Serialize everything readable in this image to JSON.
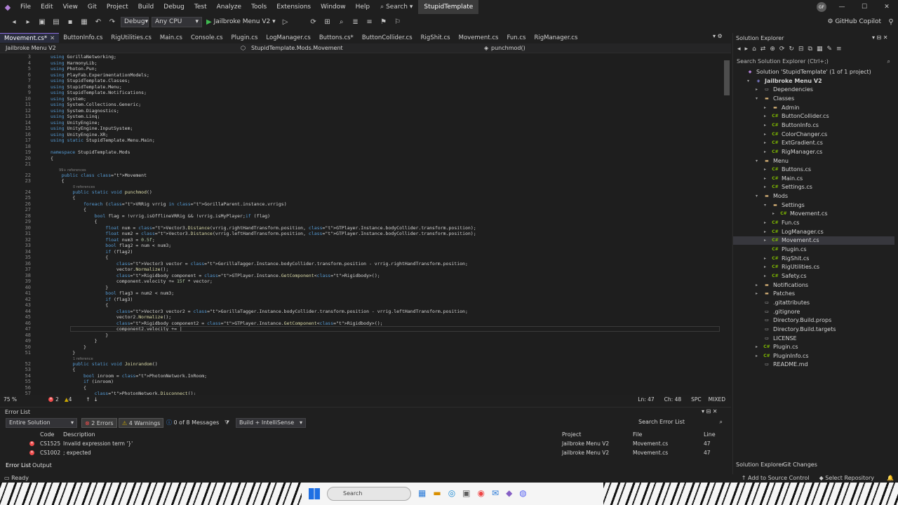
{
  "menubar": {
    "items": [
      "File",
      "Edit",
      "View",
      "Git",
      "Project",
      "Build",
      "Debug",
      "Test",
      "Analyze",
      "Tools",
      "Extensions",
      "Window",
      "Help"
    ],
    "search": "Search",
    "solution_name": "StupidTemplate",
    "avatar_initials": "GF"
  },
  "toolbar": {
    "config": "Debug",
    "platform": "Any CPU",
    "startup": "Jailbroke Menu V2",
    "copilot": "GitHub Copilot"
  },
  "tabs": [
    {
      "label": "Movement.cs*",
      "active": true
    },
    {
      "label": "ButtonInfo.cs"
    },
    {
      "label": "RigUtilities.cs"
    },
    {
      "label": "Main.cs"
    },
    {
      "label": "Console.cs"
    },
    {
      "label": "Plugin.cs"
    },
    {
      "label": "LogManager.cs"
    },
    {
      "label": "Buttons.cs*"
    },
    {
      "label": "ButtonCollider.cs"
    },
    {
      "label": "RigShit.cs"
    },
    {
      "label": "Movement.cs"
    },
    {
      "label": "Fun.cs"
    },
    {
      "label": "RigManager.cs"
    }
  ],
  "navbar": {
    "project": "Jailbroke Menu V2",
    "class": "StupidTemplate.Mods.Movement",
    "member": "punchmod()"
  },
  "editor": {
    "lines": [
      {
        "n": "3",
        "code": "using GorillaNetworking;"
      },
      {
        "n": "4",
        "code": "using HarmonyLib;"
      },
      {
        "n": "5",
        "code": "using Photon.Pun;"
      },
      {
        "n": "6",
        "code": "using PlayFab.ExperimentationModels;"
      },
      {
        "n": "7",
        "code": "using StupidTemplate.Classes;"
      },
      {
        "n": "8",
        "code": "using StupidTemplate.Menu;"
      },
      {
        "n": "9",
        "code": "using StupidTemplate.Notifications;"
      },
      {
        "n": "10",
        "code": "using System;"
      },
      {
        "n": "11",
        "code": "using System.Collections.Generic;"
      },
      {
        "n": "12",
        "code": "using System.Diagnostics;"
      },
      {
        "n": "13",
        "code": "using System.Linq;"
      },
      {
        "n": "14",
        "code": "using UnityEngine;"
      },
      {
        "n": "15",
        "code": "using UnityEngine.InputSystem;"
      },
      {
        "n": "16",
        "code": "using UnityEngine.XR;"
      },
      {
        "n": "17",
        "code": "using static StupidTemplate.Menu.Main;"
      },
      {
        "n": "18",
        "code": ""
      },
      {
        "n": "19",
        "code": "namespace StupidTemplate.Mods"
      },
      {
        "n": "20",
        "code": "{"
      },
      {
        "n": "21",
        "code": ""
      },
      {
        "n": "",
        "lens": "99+ references"
      },
      {
        "n": "22",
        "code": "    public class Movement"
      },
      {
        "n": "23",
        "code": "    {"
      },
      {
        "n": "",
        "lens": "0 references"
      },
      {
        "n": "24",
        "code": "        public static void punchmod()"
      },
      {
        "n": "25",
        "code": "        {"
      },
      {
        "n": "26",
        "code": "            foreach (VRRig vrrig in GorillaParent.instance.vrrigs)"
      },
      {
        "n": "27",
        "code": "            {"
      },
      {
        "n": "28",
        "code": "                bool flag = !vrrig.isOfflineVRRig && !vrrig.isMyPlayer;if (flag)"
      },
      {
        "n": "29",
        "code": "                {"
      },
      {
        "n": "30",
        "code": "                    float num = Vector3.Distance(vrrig.rightHandTransform.position, GTPlayer.Instance.bodyCollider.transform.position);"
      },
      {
        "n": "31",
        "code": "                    float num2 = Vector3.Distance(vrrig.leftHandTransform.position, GTPlayer.Instance.bodyCollider.transform.position);"
      },
      {
        "n": "32",
        "code": "                    float num3 = 0.5f;"
      },
      {
        "n": "33",
        "code": "                    bool flag2 = num < num3;"
      },
      {
        "n": "34",
        "code": "                    if (flag2)"
      },
      {
        "n": "35",
        "code": "                    {"
      },
      {
        "n": "36",
        "code": "                        Vector3 vector = GorillaTagger.Instance.bodyCollider.transform.position - vrrig.rightHandTransform.position;"
      },
      {
        "n": "37",
        "code": "                        vector.Normalize();"
      },
      {
        "n": "38",
        "code": "                        Rigidbody component = GTPlayer.Instance.GetComponent<Rigidbody>();"
      },
      {
        "n": "39",
        "code": "                        component.velocity += 15f * vector;"
      },
      {
        "n": "40",
        "code": "                    }"
      },
      {
        "n": "41",
        "code": "                    bool flag3 = num2 < num3;"
      },
      {
        "n": "42",
        "code": "                    if (flag3)"
      },
      {
        "n": "43",
        "code": "                    {"
      },
      {
        "n": "44",
        "code": "                        Vector3 vector2 = GorillaTagger.Instance.bodyCollider.transform.position - vrrig.leftHandTransform.position;"
      },
      {
        "n": "45",
        "code": "                        vector2.Normalize();"
      },
      {
        "n": "46",
        "code": "                        Rigidbody component2 = GTPlayer.Instance.GetComponent<Rigidbody>();"
      },
      {
        "n": "47",
        "code": "                        component2.velocity += |"
      },
      {
        "n": "48",
        "code": "                    }"
      },
      {
        "n": "49",
        "code": "                }"
      },
      {
        "n": "50",
        "code": "            }"
      },
      {
        "n": "51",
        "code": "        }"
      },
      {
        "n": "",
        "lens": "1 reference"
      },
      {
        "n": "52",
        "code": "        public static void Joinrandom()"
      },
      {
        "n": "53",
        "code": "        {"
      },
      {
        "n": "54",
        "code": "            bool inroom = PhotonNetwork.InRoom;"
      },
      {
        "n": "55",
        "code": "            if (inroom)"
      },
      {
        "n": "56",
        "code": "            {"
      },
      {
        "n": "57",
        "code": "                PhotonNetwork.Disconnect();"
      }
    ]
  },
  "editor_status": {
    "zoom": "75 %",
    "errors": "2",
    "warnings": "4",
    "position": "Ln: 47",
    "column": "Ch: 48",
    "spaces": "SPC",
    "eol": "MIXED"
  },
  "error_list": {
    "title": "Error List",
    "scope": "Entire Solution",
    "errors_btn": "2 Errors",
    "warnings_btn": "4 Warnings",
    "messages_btn": "0 of 8 Messages",
    "build_filter": "Build + IntelliSense",
    "search_placeholder": "Search Error List",
    "headers": {
      "code": "Code",
      "description": "Description",
      "project": "Project",
      "file": "File",
      "line": "Line"
    },
    "rows": [
      {
        "code": "CS1525",
        "description": "Invalid expression term '}'",
        "project": "Jailbroke Menu V2",
        "file": "Movement.cs",
        "line": "47"
      },
      {
        "code": "CS1002",
        "description": "; expected",
        "project": "Jailbroke Menu V2",
        "file": "Movement.cs",
        "line": "47"
      }
    ],
    "bottom_tabs": [
      "Error List",
      "Output"
    ]
  },
  "solution_explorer": {
    "title": "Solution Explorer",
    "search": "Search Solution Explorer (Ctrl+;)",
    "items": [
      {
        "label": "Solution 'StupidTemplate' (1 of 1 project)",
        "depth": 0,
        "icon": "sol",
        "exp": ""
      },
      {
        "label": "Jailbroke Menu V2",
        "depth": 1,
        "icon": "proj",
        "exp": "▾",
        "bold": true
      },
      {
        "label": "Dependencies",
        "depth": 2,
        "icon": "file",
        "exp": "▸"
      },
      {
        "label": "Classes",
        "depth": 2,
        "icon": "folder",
        "exp": "▾"
      },
      {
        "label": "Admin",
        "depth": 3,
        "icon": "folder",
        "exp": "▸"
      },
      {
        "label": "ButtonCollider.cs",
        "depth": 3,
        "icon": "cs",
        "exp": "▸"
      },
      {
        "label": "ButtonInfo.cs",
        "depth": 3,
        "icon": "cs",
        "exp": "▸"
      },
      {
        "label": "ColorChanger.cs",
        "depth": 3,
        "icon": "cs",
        "exp": "▸"
      },
      {
        "label": "ExtGradient.cs",
        "depth": 3,
        "icon": "cs",
        "exp": "▸"
      },
      {
        "label": "RigManager.cs",
        "depth": 3,
        "icon": "cs",
        "exp": "▸"
      },
      {
        "label": "Menu",
        "depth": 2,
        "icon": "folder",
        "exp": "▾"
      },
      {
        "label": "Buttons.cs",
        "depth": 3,
        "icon": "cs",
        "exp": "▸"
      },
      {
        "label": "Main.cs",
        "depth": 3,
        "icon": "cs",
        "exp": "▸"
      },
      {
        "label": "Settings.cs",
        "depth": 3,
        "icon": "cs",
        "exp": "▸"
      },
      {
        "label": "Mods",
        "depth": 2,
        "icon": "folder",
        "exp": "▾"
      },
      {
        "label": "Settings",
        "depth": 3,
        "icon": "folder",
        "exp": "▾"
      },
      {
        "label": "Movement.cs",
        "depth": 4,
        "icon": "cs",
        "exp": "▸"
      },
      {
        "label": "Fun.cs",
        "depth": 3,
        "icon": "cs",
        "exp": "▸"
      },
      {
        "label": "LogManager.cs",
        "depth": 3,
        "icon": "cs",
        "exp": "▸"
      },
      {
        "label": "Movement.cs",
        "depth": 3,
        "icon": "cs",
        "exp": "▸",
        "selected": true
      },
      {
        "label": "Plugin.cs",
        "depth": 3,
        "icon": "cs",
        "exp": ""
      },
      {
        "label": "RigShit.cs",
        "depth": 3,
        "icon": "cs",
        "exp": "▸"
      },
      {
        "label": "RigUtilities.cs",
        "depth": 3,
        "icon": "cs",
        "exp": "▸"
      },
      {
        "label": "Safety.cs",
        "depth": 3,
        "icon": "cs",
        "exp": "▸"
      },
      {
        "label": "Notifications",
        "depth": 2,
        "icon": "folder",
        "exp": "▸"
      },
      {
        "label": "Patches",
        "depth": 2,
        "icon": "folder",
        "exp": "▸"
      },
      {
        "label": ".gitattributes",
        "depth": 2,
        "icon": "file",
        "exp": ""
      },
      {
        "label": ".gitignore",
        "depth": 2,
        "icon": "file",
        "exp": ""
      },
      {
        "label": "Directory.Build.props",
        "depth": 2,
        "icon": "file",
        "exp": ""
      },
      {
        "label": "Directory.Build.targets",
        "depth": 2,
        "icon": "file",
        "exp": ""
      },
      {
        "label": "LICENSE",
        "depth": 2,
        "icon": "file",
        "exp": ""
      },
      {
        "label": "Plugin.cs",
        "depth": 2,
        "icon": "cs",
        "exp": "▸"
      },
      {
        "label": "PluginInfo.cs",
        "depth": 2,
        "icon": "cs",
        "exp": "▸"
      },
      {
        "label": "README.md",
        "depth": 2,
        "icon": "file",
        "exp": ""
      }
    ],
    "bottom_tabs": [
      "Solution Explorer",
      "Git Changes"
    ]
  },
  "statusbar": {
    "ready": "Ready",
    "add_source": "Add to Source Control",
    "select_repo": "Select Repository"
  },
  "taskbar": {
    "search": "Search"
  },
  "colors": {
    "accent": "#8a6ee0",
    "error": "#f14c4c",
    "keyword": "#569cd6",
    "type": "#4ec9b0"
  }
}
